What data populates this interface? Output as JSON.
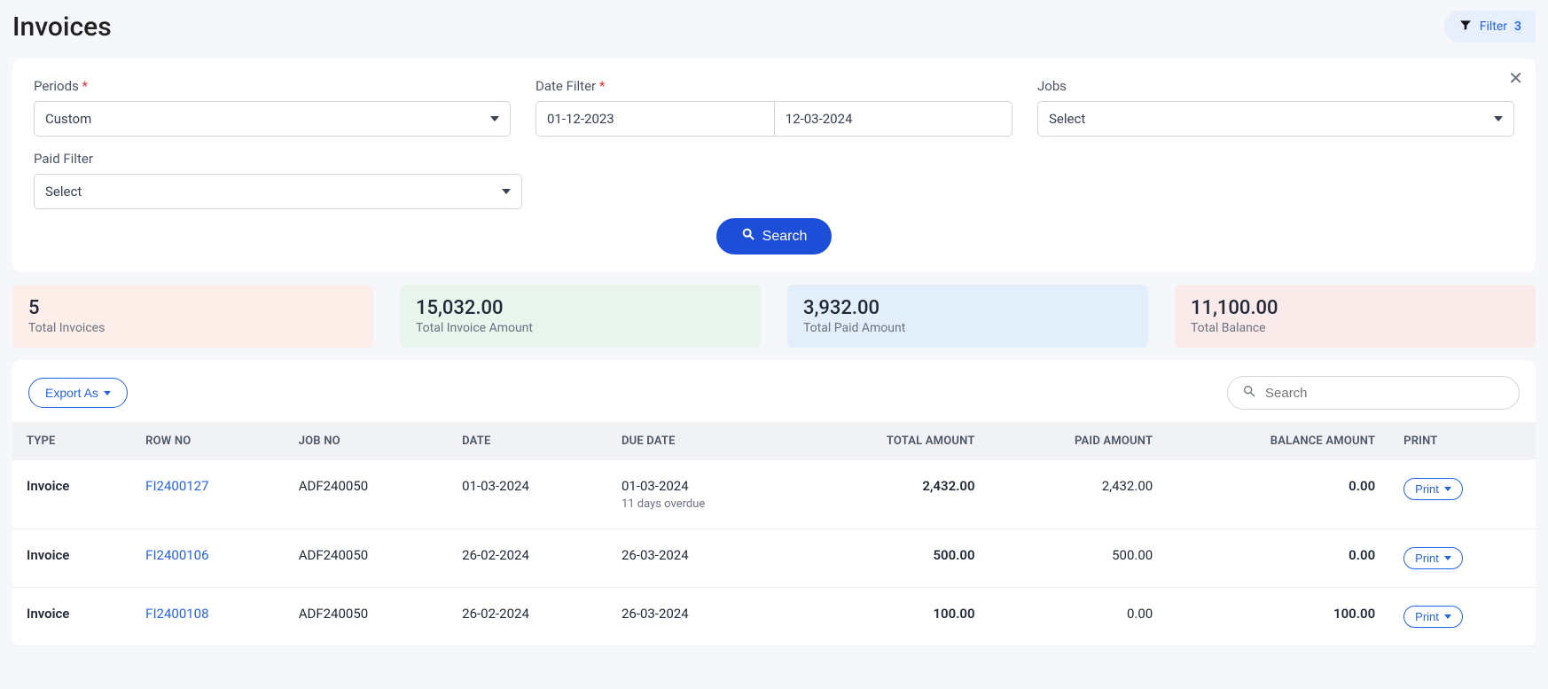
{
  "header": {
    "title": "Invoices",
    "filter_label": "Filter",
    "filter_count": "3"
  },
  "filters": {
    "periods": {
      "label": "Periods",
      "value": "Custom"
    },
    "date_filter": {
      "label": "Date Filter",
      "from": "01-12-2023",
      "to": "12-03-2024"
    },
    "jobs": {
      "label": "Jobs",
      "value": "Select"
    },
    "paid": {
      "label": "Paid Filter",
      "value": "Select"
    },
    "search_button": "Search"
  },
  "summary": [
    {
      "value": "5",
      "label": "Total Invoices"
    },
    {
      "value": "15,032.00",
      "label": "Total Invoice Amount"
    },
    {
      "value": "3,932.00",
      "label": "Total Paid Amount"
    },
    {
      "value": "11,100.00",
      "label": "Total Balance"
    }
  ],
  "toolbar": {
    "export_label": "Export As",
    "search_placeholder": "Search"
  },
  "table": {
    "columns": [
      "TYPE",
      "ROW NO",
      "JOB NO",
      "DATE",
      "DUE DATE",
      "TOTAL AMOUNT",
      "PAID AMOUNT",
      "BALANCE AMOUNT",
      "PRINT"
    ],
    "print_label": "Print",
    "rows": [
      {
        "type": "Invoice",
        "row_no": "FI2400127",
        "job_no": "ADF240050",
        "date": "01-03-2024",
        "due_date": "01-03-2024",
        "overdue": "11 days overdue",
        "total": "2,432.00",
        "paid": "2,432.00",
        "balance": "0.00"
      },
      {
        "type": "Invoice",
        "row_no": "FI2400106",
        "job_no": "ADF240050",
        "date": "26-02-2024",
        "due_date": "26-03-2024",
        "overdue": "",
        "total": "500.00",
        "paid": "500.00",
        "balance": "0.00"
      },
      {
        "type": "Invoice",
        "row_no": "FI2400108",
        "job_no": "ADF240050",
        "date": "26-02-2024",
        "due_date": "26-03-2024",
        "overdue": "",
        "total": "100.00",
        "paid": "0.00",
        "balance": "100.00"
      }
    ]
  }
}
